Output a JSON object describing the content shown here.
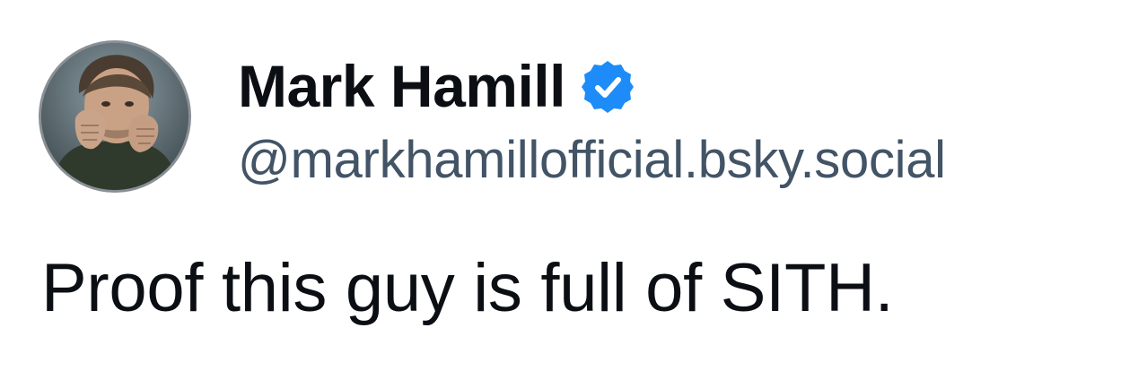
{
  "author": {
    "display_name": "Mark Hamill",
    "handle": "@markhamillofficial.bsky.social",
    "verified_icon": "verified-badge-icon",
    "avatar_icon": "avatar-photo"
  },
  "post": {
    "text": "Proof this guy is full of SITH."
  },
  "colors": {
    "verified": "#1d8cf8",
    "name": "#0b0f14",
    "handle": "#425466",
    "text": "#0b0f14"
  }
}
